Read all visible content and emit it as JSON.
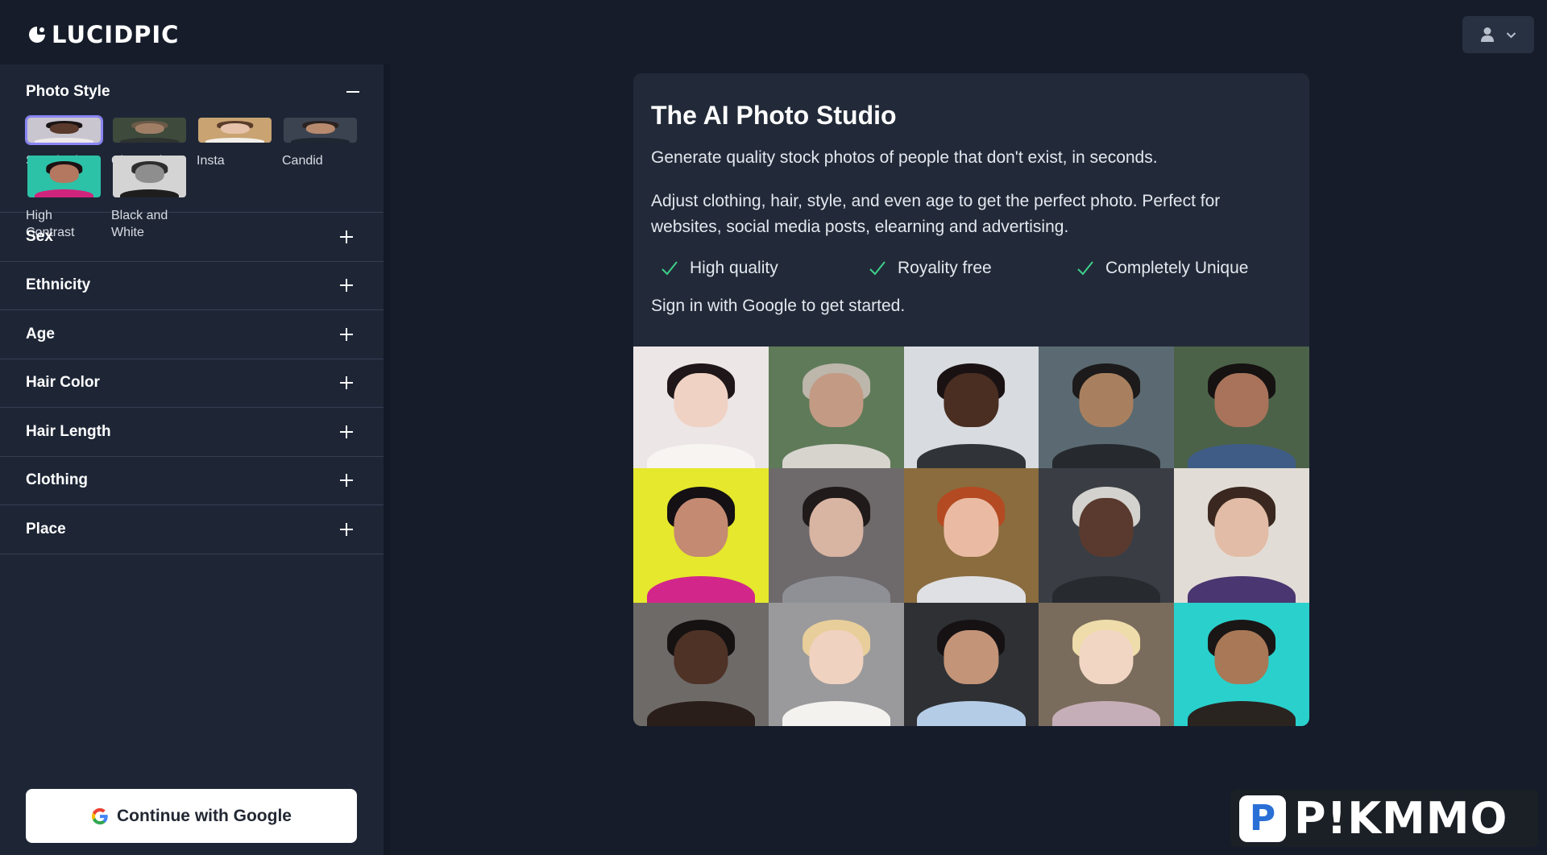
{
  "app": {
    "logo_text": "LUCIDPIC"
  },
  "user_menu": {
    "icon": "user-icon",
    "chevron": "chevron-down-icon"
  },
  "sidebar": {
    "photo_style": {
      "title": "Photo Style",
      "styles": [
        {
          "label": "Standard",
          "selected": true,
          "colors": {
            "bg": "#c9c6cf",
            "skin": "#5a3a2c",
            "hair": "#1a1416",
            "cloth": "#efe9ea"
          }
        },
        {
          "label": "Cinematic",
          "selected": false,
          "colors": {
            "bg": "#3e4a3c",
            "skin": "#a07e66",
            "hair": "#6b5a48",
            "cloth": "#2d3330"
          }
        },
        {
          "label": "Insta",
          "selected": false,
          "colors": {
            "bg": "#c9a372",
            "skin": "#e5c2a9",
            "hair": "#5a3c2a",
            "cloth": "#f3f0ea"
          }
        },
        {
          "label": "Candid",
          "selected": false,
          "colors": {
            "bg": "#3c4350",
            "skin": "#b78a6e",
            "hair": "#2a2220",
            "cloth": "#1e2632"
          }
        },
        {
          "label": "High Contrast",
          "selected": false,
          "colors": {
            "bg": "#2cc2a8",
            "skin": "#b3785f",
            "hair": "#1c1214",
            "cloth": "#d0237c"
          }
        },
        {
          "label": "Black and White",
          "selected": false,
          "colors": {
            "bg": "#d4d4d4",
            "skin": "#8e8e8e",
            "hair": "#2e2e2e",
            "cloth": "#1e1e1e"
          }
        }
      ]
    },
    "sections": [
      {
        "label": "Sex"
      },
      {
        "label": "Ethnicity"
      },
      {
        "label": "Age"
      },
      {
        "label": "Hair Color"
      },
      {
        "label": "Hair Length"
      },
      {
        "label": "Clothing"
      },
      {
        "label": "Place"
      }
    ],
    "google_button": {
      "label": "Continue with Google",
      "icon": "google-icon"
    }
  },
  "card": {
    "title": "The AI Photo Studio",
    "intro": "Generate quality stock photos of people that don't exist, in seconds.",
    "description": "Adjust clothing, hair, style, and even age to get the perfect photo. Perfect for websites, social media posts, elearning and advertising.",
    "features": [
      "High quality",
      "Royality free",
      "Completely Unique"
    ],
    "signin_text": "Sign in with Google to get started.",
    "photos": [
      {
        "bg": "#ece6e6",
        "skin": "#f0d2c4",
        "hair": "#1e1618",
        "cloth": "#f7f4f1"
      },
      {
        "bg": "#5f7a58",
        "skin": "#c39a84",
        "hair": "#bcb6ab",
        "cloth": "#d7d4ce"
      },
      {
        "bg": "#d8dbe0",
        "skin": "#4a2e22",
        "hair": "#1a1212",
        "cloth": "#303338"
      },
      {
        "bg": "#5b6a72",
        "skin": "#a9805f",
        "hair": "#1c1a1a",
        "cloth": "#262a2e"
      },
      {
        "bg": "#4c6248",
        "skin": "#a8735a",
        "hair": "#161212",
        "cloth": "#3e5c86"
      },
      {
        "bg": "#e5e82c",
        "skin": "#c48a72",
        "hair": "#141014",
        "cloth": "#d3268a"
      },
      {
        "bg": "#6e6a6c",
        "skin": "#d8b4a2",
        "hair": "#201a1a",
        "cloth": "#8e9096"
      },
      {
        "bg": "#8a6c3e",
        "skin": "#eabba2",
        "hair": "#b44a22",
        "cloth": "#dfe0e4"
      },
      {
        "bg": "#3a3e44",
        "skin": "#5a3a2e",
        "hair": "#d4d2ce",
        "cloth": "#272b30"
      },
      {
        "bg": "#e2dcd6",
        "skin": "#e2bca6",
        "hair": "#3a2820",
        "cloth": "#4a3670"
      },
      {
        "bg": "#6e6a68",
        "skin": "#4e3226",
        "hair": "#161212",
        "cloth": "#2a1e1a"
      },
      {
        "bg": "#9a9a9c",
        "skin": "#f0d2c0",
        "hair": "#e8ce9a",
        "cloth": "#f4f2ee"
      },
      {
        "bg": "#2e3034",
        "skin": "#c49478",
        "hair": "#161214",
        "cloth": "#b4cce6"
      },
      {
        "bg": "#7a6c5c",
        "skin": "#f2d6c4",
        "hair": "#eedcaa",
        "cloth": "#c6aeb8"
      },
      {
        "bg": "#2ad0cc",
        "skin": "#a97856",
        "hair": "#1a1616",
        "cloth": "#2a2420"
      }
    ]
  },
  "watermark": {
    "badge": "P",
    "text": "P!KMMO"
  },
  "colors": {
    "check": "#3fd08a",
    "selected_border": "#8a86f5"
  }
}
